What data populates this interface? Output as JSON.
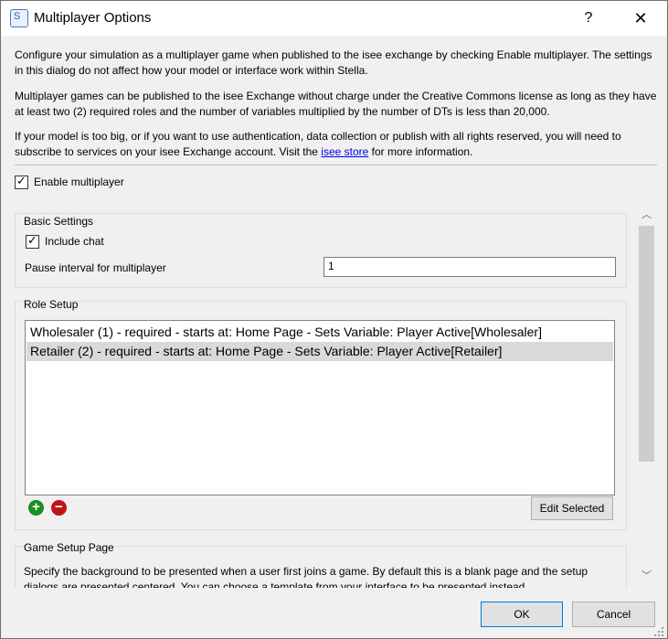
{
  "window": {
    "title": "Multiplayer Options",
    "app_icon": "stella-app-icon",
    "app_icon_text": "S",
    "help_label": "?",
    "close_label": "✕"
  },
  "intro": {
    "p1": "Configure your simulation as a multiplayer game when published to the isee exchange by checking Enable multiplayer. The settings in this dialog do not affect how your model or interface work within Stella.",
    "p2": "Multiplayer games can be published to the isee Exchange without charge under the Creative Commons license as long as they have at least two (2) required roles and the number of variables multiplied by the number of DTs is less than 20,000.",
    "p3_before": "If your model is too big, or if you want to use authentication, data collection or publish with all rights reserved, you will need to subscribe to services on your isee Exchange account. Visit the ",
    "p3_link": "isee store",
    "p3_after": " for more information."
  },
  "enable_multiplayer": {
    "label": "Enable multiplayer",
    "checked": true
  },
  "basic_settings": {
    "title": "Basic Settings",
    "include_chat": {
      "label": "Include chat",
      "checked": true
    },
    "pause_interval": {
      "label": "Pause interval for multiplayer",
      "value": "1"
    }
  },
  "role_setup": {
    "title": "Role Setup",
    "roles": [
      {
        "text": "Wholesaler (1) - required - starts at: Home Page - Sets Variable: Player Active[Wholesaler]",
        "selected": false
      },
      {
        "text": "Retailer (2) - required - starts at: Home Page - Sets Variable: Player Active[Retailer]",
        "selected": true
      }
    ],
    "add_icon": "+",
    "remove_icon": "−",
    "edit_button": "Edit Selected"
  },
  "game_setup": {
    "title": "Game Setup Page",
    "description": "Specify the background to be presented when a user first joins a game. By default this is a blank page and the setup dialogs are presented centered. You can choose a template from your interface to be presented instead."
  },
  "scrollbar": {
    "up": "︿",
    "down": "﹀"
  },
  "buttons": {
    "ok": "OK",
    "cancel": "Cancel"
  },
  "colors": {
    "link": "#0000ee",
    "add": "#1e8c1e",
    "remove": "#c0131a",
    "primary_border": "#0078d7",
    "selection": "#d9d9d9"
  }
}
